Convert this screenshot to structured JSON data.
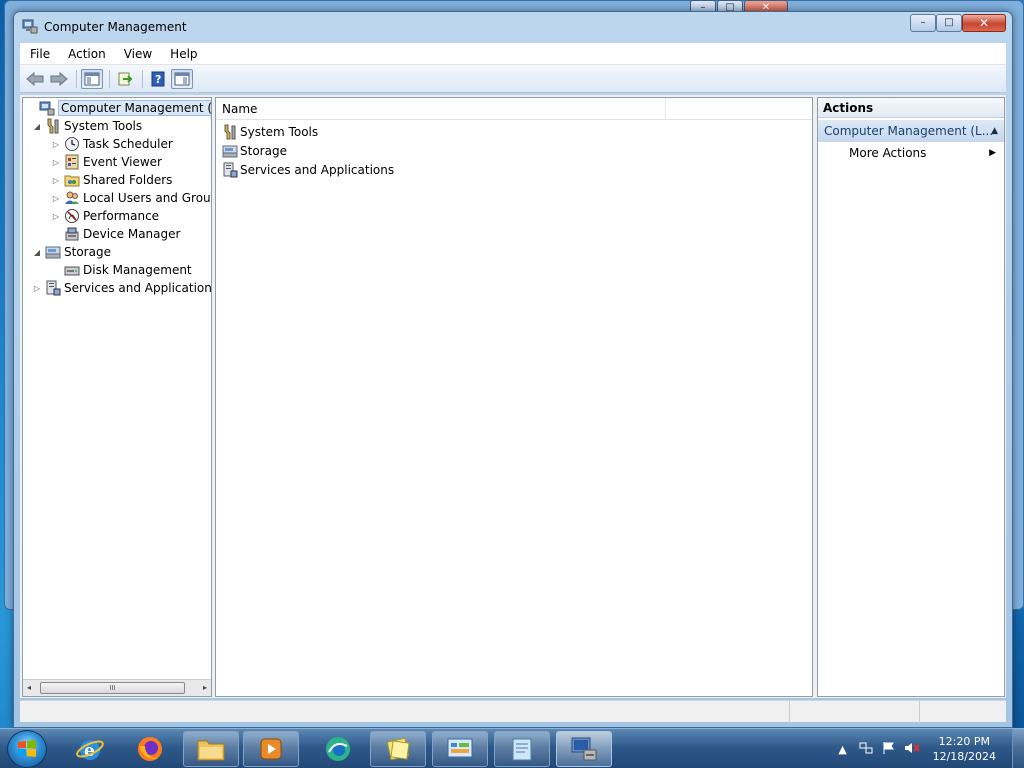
{
  "window": {
    "title": "Computer Management",
    "minimize": "–",
    "maximize": "□",
    "close": "✕"
  },
  "menu": [
    "File",
    "Action",
    "View",
    "Help"
  ],
  "toolbar": {
    "icons": [
      "back-arrow-icon",
      "forward-arrow-icon",
      "show-hide-console-tree-icon",
      "export-list-icon",
      "help-icon",
      "show-hide-action-pane-icon"
    ]
  },
  "tree": {
    "items": [
      {
        "label": "Computer Management (Local",
        "icon": "computer-management-icon",
        "expander": "",
        "selected": true
      },
      {
        "label": "System Tools",
        "icon": "tools-icon",
        "expander": "◢"
      },
      {
        "label": "Task Scheduler",
        "icon": "clock-icon",
        "expander": "▷"
      },
      {
        "label": "Event Viewer",
        "icon": "event-viewer-icon",
        "expander": "▷"
      },
      {
        "label": "Shared Folders",
        "icon": "shared-folder-icon",
        "expander": "▷"
      },
      {
        "label": "Local Users and Groups",
        "icon": "users-icon",
        "expander": "▷"
      },
      {
        "label": "Performance",
        "icon": "performance-icon",
        "expander": "▷"
      },
      {
        "label": "Device Manager",
        "icon": "device-manager-icon",
        "expander": ""
      },
      {
        "label": "Storage",
        "icon": "storage-icon",
        "expander": "◢"
      },
      {
        "label": "Disk Management",
        "icon": "disk-icon",
        "expander": ""
      },
      {
        "label": "Services and Applications",
        "icon": "services-icon",
        "expander": "▷"
      }
    ],
    "scroll_left": "◂",
    "scroll_right": "▸",
    "scroll_grip": "III"
  },
  "list": {
    "column_name": "Name",
    "items": [
      {
        "label": "System Tools",
        "icon": "tools-icon"
      },
      {
        "label": "Storage",
        "icon": "storage-icon"
      },
      {
        "label": "Services and Applications",
        "icon": "services-icon"
      }
    ]
  },
  "actions": {
    "title": "Actions",
    "section": "Computer Management (L...",
    "section_arrow": "▲",
    "more": "More Actions",
    "more_arrow": "▶"
  },
  "taskbar": {
    "apps": [
      "internet-explorer-icon",
      "firefox-icon",
      "file-explorer-icon",
      "media-player-icon",
      "edge-icon",
      "sticky-notes-icon",
      "control-panel-icon",
      "notepad-icon",
      "computer-management-icon"
    ],
    "tray_arrow": "▲",
    "time": "12:20 PM",
    "date": "12/18/2024"
  },
  "colors": {
    "accent": "#2f5a8a",
    "selection": "#d9e7f7",
    "action_header": "#c4d7ee"
  }
}
